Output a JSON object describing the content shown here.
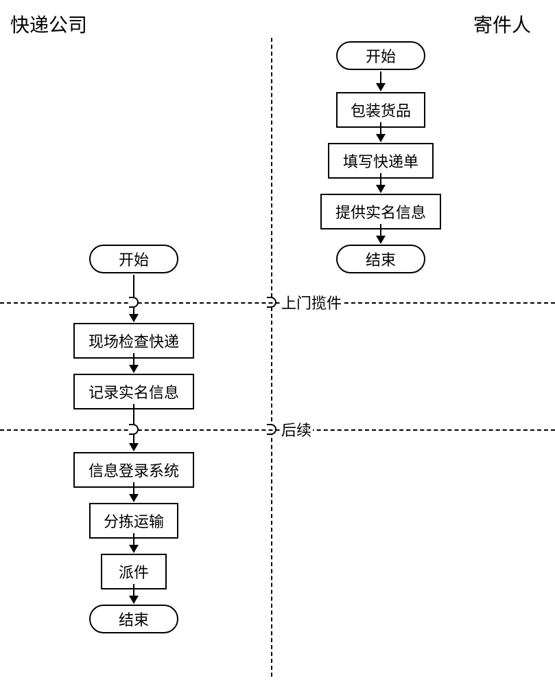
{
  "swimlanes": {
    "left": {
      "title": "快递公司"
    },
    "right": {
      "title": "寄件人"
    }
  },
  "phases": {
    "pickup": "上门揽件",
    "followup": "后续"
  },
  "right_flow": {
    "start": "开始",
    "step1": "包装货品",
    "step2": "填写快递单",
    "step3": "提供实名信息",
    "end": "结束"
  },
  "left_flow": {
    "start": "开始",
    "step1": "现场检查快递",
    "step2": "记录实名信息",
    "step3": "信息登录系统",
    "step4": "分拣运输",
    "step5": "派件",
    "end": "结束"
  },
  "chart_data": {
    "type": "flowchart",
    "swimlanes": [
      "快递公司",
      "寄件人"
    ],
    "phases": [
      "",
      "上门揽件",
      "后续"
    ],
    "flows": [
      {
        "lane": "寄件人",
        "nodes": [
          {
            "id": "r_start",
            "type": "terminator",
            "label": "开始"
          },
          {
            "id": "r1",
            "type": "process",
            "label": "包装货品"
          },
          {
            "id": "r2",
            "type": "process",
            "label": "填写快递单"
          },
          {
            "id": "r3",
            "type": "process",
            "label": "提供实名信息"
          },
          {
            "id": "r_end",
            "type": "terminator",
            "label": "结束"
          }
        ],
        "edges": [
          [
            "r_start",
            "r1"
          ],
          [
            "r1",
            "r2"
          ],
          [
            "r2",
            "r3"
          ],
          [
            "r3",
            "r_end"
          ]
        ]
      },
      {
        "lane": "快递公司",
        "nodes": [
          {
            "id": "l_start",
            "type": "terminator",
            "label": "开始",
            "phase": 0
          },
          {
            "id": "l1",
            "type": "process",
            "label": "现场检查快递",
            "phase": 1
          },
          {
            "id": "l2",
            "type": "process",
            "label": "记录实名信息",
            "phase": 1
          },
          {
            "id": "l3",
            "type": "process",
            "label": "信息登录系统",
            "phase": 2
          },
          {
            "id": "l4",
            "type": "process",
            "label": "分拣运输",
            "phase": 2
          },
          {
            "id": "l5",
            "type": "process",
            "label": "派件",
            "phase": 2
          },
          {
            "id": "l_end",
            "type": "terminator",
            "label": "结束",
            "phase": 2
          }
        ],
        "edges": [
          [
            "l_start",
            "l1"
          ],
          [
            "l1",
            "l2"
          ],
          [
            "l2",
            "l3"
          ],
          [
            "l3",
            "l4"
          ],
          [
            "l4",
            "l5"
          ],
          [
            "l5",
            "l_end"
          ]
        ]
      }
    ]
  }
}
